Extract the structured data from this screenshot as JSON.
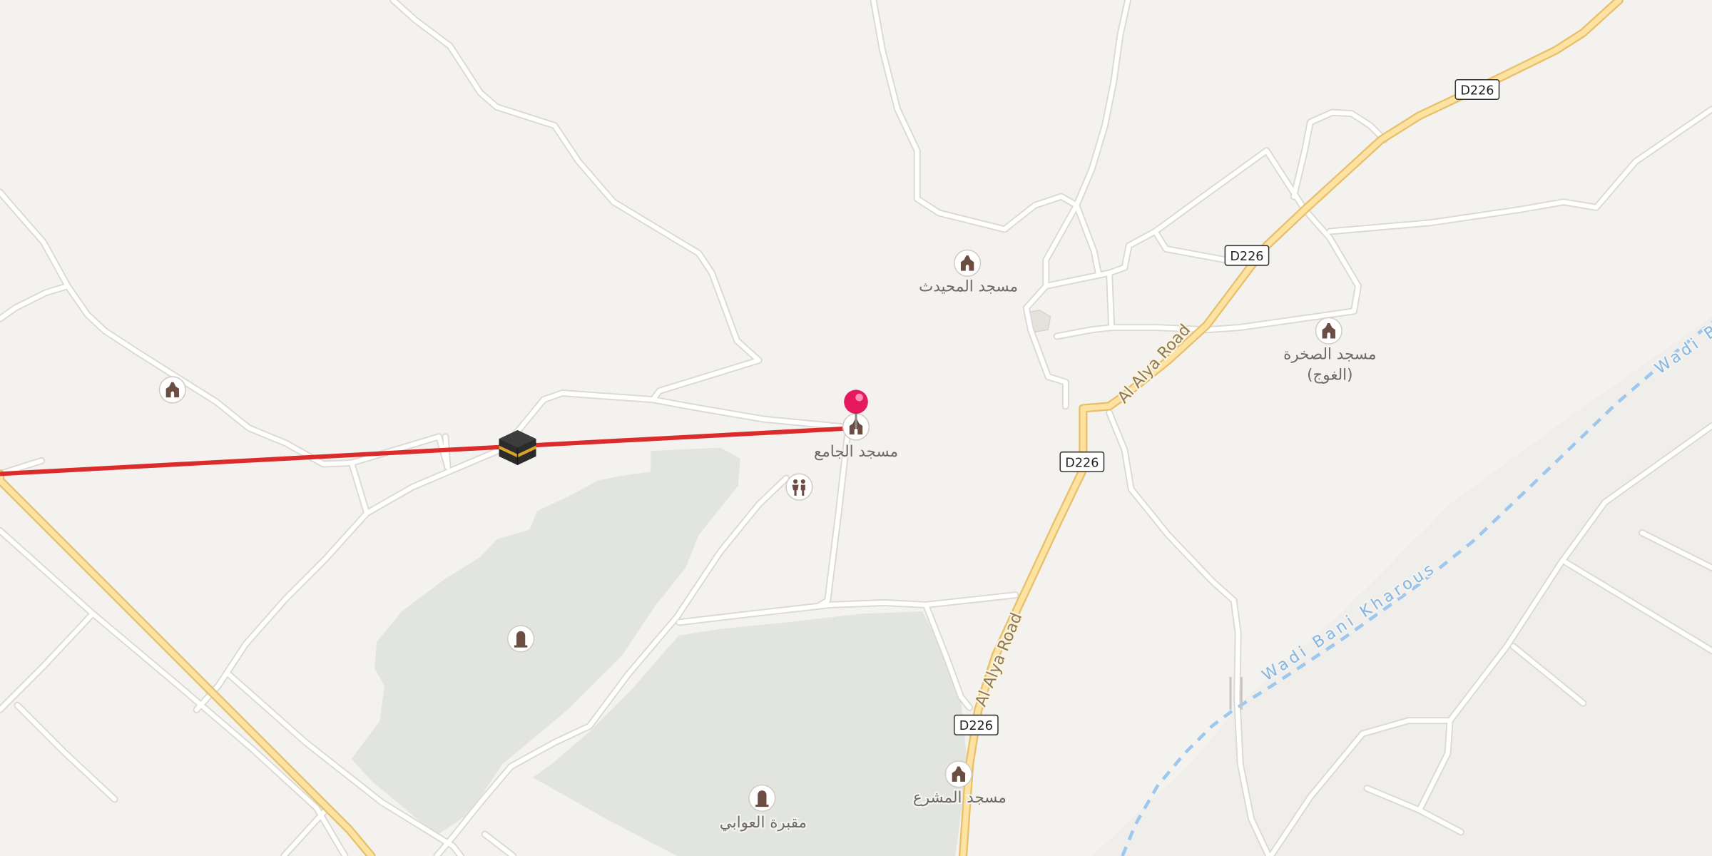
{
  "map": {
    "roads": {
      "main_name": "Al Alya Road",
      "route_number": "D226"
    },
    "waterways": {
      "wadi_name": "Wadi Bani Kharous",
      "wadi_name_cut": "Wadi B"
    },
    "places": {
      "mosque_muhaydath": "مسجد المحيدث",
      "mosque_sakhra_line1": "مسجد الصخرة",
      "mosque_sakhra_line2": "(الغوج)",
      "mosque_jami": "مسجد الجامع",
      "mosque_mashra": "مسجد المشرع",
      "cemetery_awabi": "مقبرة العوابي"
    },
    "icons": {
      "mosque": "mosque-icon",
      "kaaba": "kaaba-icon",
      "school": "school-icon",
      "cemetery": "cemetery-icon",
      "location_pin": "location-pin-icon"
    },
    "colors": {
      "background": "#f4f2ef",
      "minor_road": "#ffffff",
      "minor_road_casing": "#dcd9d4",
      "main_road": "#fde3a2",
      "main_road_casing": "#e8bf6a",
      "green_area": "#e2e4df",
      "waterway": "#9cc7ef",
      "qibla_line": "#dc2b2b",
      "pin": "#e6185e"
    }
  }
}
